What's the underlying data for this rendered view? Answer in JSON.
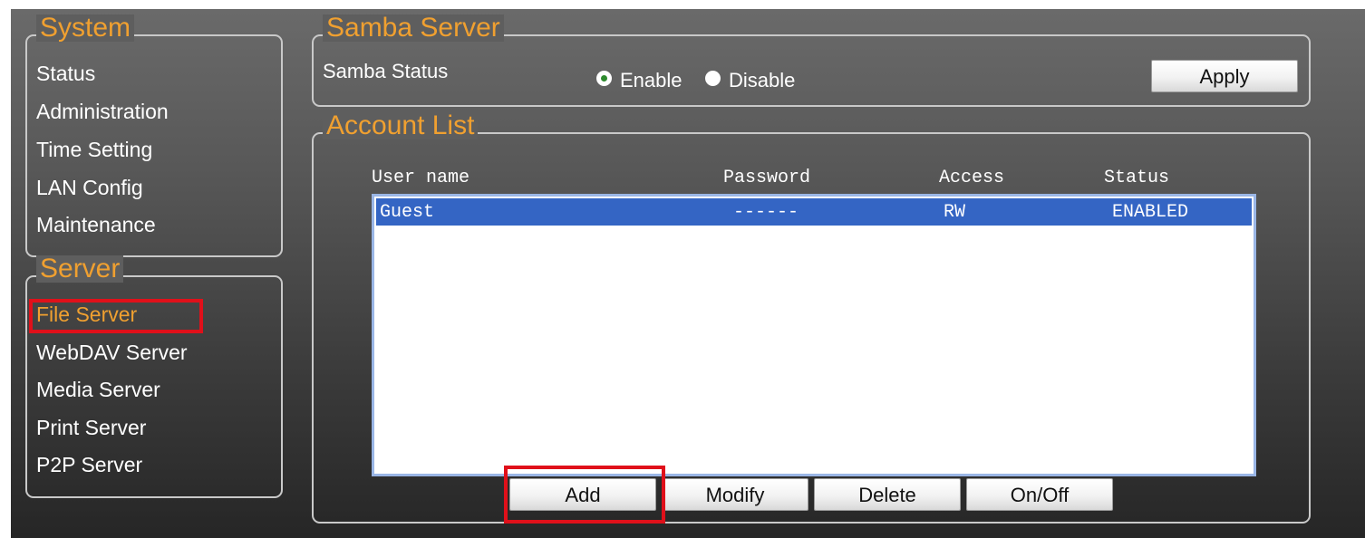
{
  "system": {
    "title": "System",
    "items": [
      "Status",
      "Administration",
      "Time Setting",
      "LAN Config",
      "Maintenance"
    ]
  },
  "server": {
    "title": "Server",
    "items": [
      "File Server",
      "WebDAV Server",
      "Media Server",
      "Print Server",
      "P2P Server"
    ],
    "active": "File Server"
  },
  "samba": {
    "title": "Samba Server",
    "status_label": "Samba Status",
    "enable_label": "Enable",
    "disable_label": "Disable",
    "selected": "Enable",
    "apply_label": "Apply"
  },
  "accounts": {
    "title": "Account List",
    "columns": [
      "User name",
      "Password",
      "Access",
      "Status"
    ],
    "rows": [
      {
        "user": "Guest",
        "password": "------",
        "access": "RW",
        "status": "ENABLED"
      }
    ],
    "buttons": [
      "Add",
      "Modify",
      "Delete",
      "On/Off"
    ]
  },
  "colors": {
    "accent": "#f0a030",
    "highlight_box": "#e0101a",
    "selected_row": "#3465c4"
  }
}
